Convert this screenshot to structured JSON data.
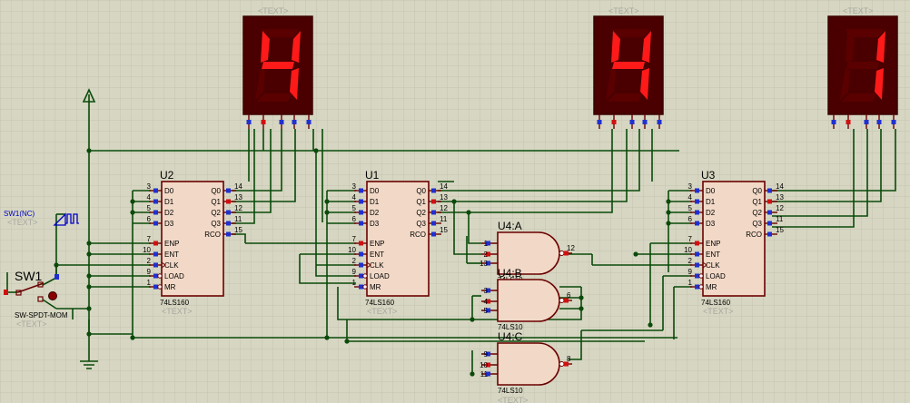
{
  "text_placeholder": "<TEXT>",
  "colors": {
    "grid": "#c4c4b0",
    "wire": "#0a4a0a",
    "chip_fill": "#f2d9c7",
    "chip_border": "#6b0000",
    "seg_on": "#ff1a1a",
    "seg_off": "#5a0000"
  },
  "displays": [
    {
      "name": "display-left",
      "digit": "4"
    },
    {
      "name": "display-middle",
      "digit": "4"
    },
    {
      "name": "display-right",
      "digit": "1"
    }
  ],
  "counters": [
    {
      "ref": "U2",
      "part": "74LS160"
    },
    {
      "ref": "U1",
      "part": "74LS160"
    },
    {
      "ref": "U3",
      "part": "74LS160"
    }
  ],
  "counter_inputs": [
    {
      "pin": "3",
      "label": "D0"
    },
    {
      "pin": "4",
      "label": "D1"
    },
    {
      "pin": "5",
      "label": "D2"
    },
    {
      "pin": "6",
      "label": "D3"
    },
    {
      "pin": "7",
      "label": "ENP"
    },
    {
      "pin": "10",
      "label": "ENT"
    },
    {
      "pin": "2",
      "label": "CLK"
    },
    {
      "pin": "9",
      "label": "LOAD"
    },
    {
      "pin": "1",
      "label": "MR"
    }
  ],
  "counter_outputs": [
    {
      "pin": "14",
      "label": "Q0"
    },
    {
      "pin": "13",
      "label": "Q1"
    },
    {
      "pin": "12",
      "label": "Q2"
    },
    {
      "pin": "11",
      "label": "Q3"
    },
    {
      "pin": "15",
      "label": "RCO"
    }
  ],
  "gates": [
    {
      "ref": "U4:A",
      "inputs": [
        "1",
        "2",
        "13"
      ],
      "output": "12",
      "part": "74LS10"
    },
    {
      "ref": "U4:B",
      "inputs": [
        "3",
        "4",
        "5"
      ],
      "output": "6",
      "part": "74LS10"
    },
    {
      "ref": "U4:C",
      "inputs": [
        "9",
        "10",
        "11"
      ],
      "output": "8",
      "part": "74LS10"
    }
  ],
  "switch": {
    "ref": "SW1",
    "part": "SW-SPDT-MOM"
  },
  "clock": {
    "label": "SW1(NC)"
  }
}
